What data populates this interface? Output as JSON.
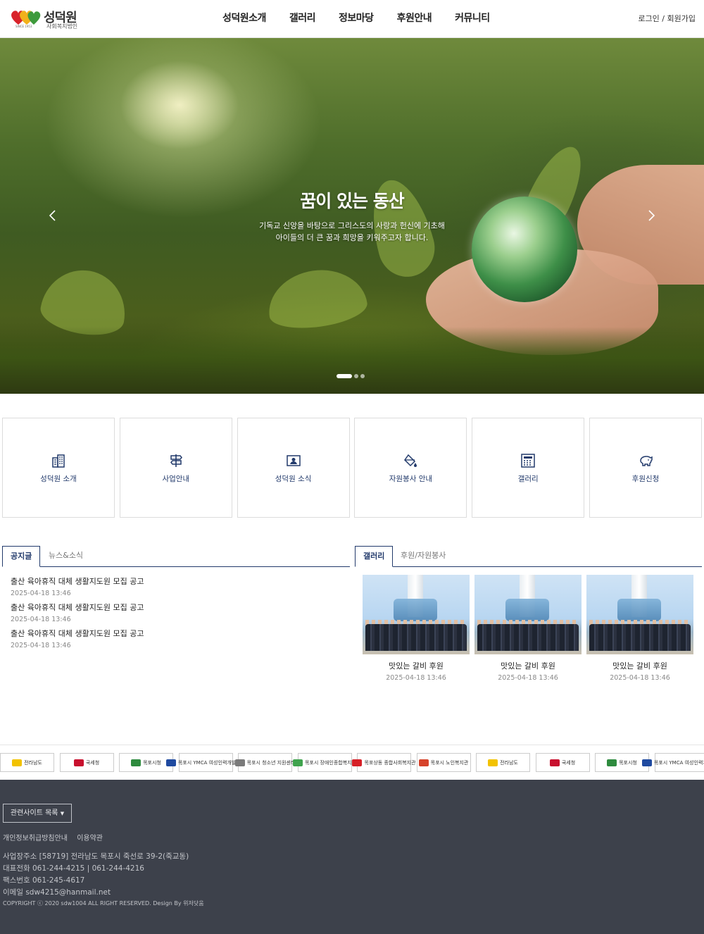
{
  "header": {
    "logo_name": "성덕원",
    "logo_sub": "사회복지법인",
    "logo_since": "SINCE 1953",
    "nav": [
      "성덕원소개",
      "갤러리",
      "정보마당",
      "후원안내",
      "커뮤니티"
    ],
    "login": "로그인",
    "separator": " / ",
    "signup": "회원가입"
  },
  "hero": {
    "title": "꿈이 있는 동산",
    "desc_line1": "기독교 신앙을 바탕으로 그리스도의 사랑과 헌신에 기초해",
    "desc_line2": "아이들의 더 큰 꿈과 희망을 키워주고자 합니다.",
    "slide_count": 3,
    "active_slide": 1
  },
  "quick_menu": [
    {
      "label": "성덕원 소개",
      "icon": "building-icon"
    },
    {
      "label": "사업안내",
      "icon": "signpost-icon"
    },
    {
      "label": "성덕원 소식",
      "icon": "contact-card-icon"
    },
    {
      "label": "자원봉사 안내",
      "icon": "paint-bucket-icon"
    },
    {
      "label": "갤러리",
      "icon": "calculator-icon"
    },
    {
      "label": "후원신청",
      "icon": "piggy-bank-icon"
    }
  ],
  "board": {
    "tab_active": "공지글",
    "tab_other": "뉴스&소식",
    "items": [
      {
        "title": "출산 육아휴직 대체 생활지도원 모집 공고",
        "date": "2025-04-18 13:46"
      },
      {
        "title": "출산 육아휴직 대체 생활지도원 모집 공고",
        "date": "2025-04-18 13:46"
      },
      {
        "title": "출산 육아휴직 대체 생활지도원 모집 공고",
        "date": "2025-04-18 13:46"
      }
    ]
  },
  "gallery": {
    "tab_active": "갤러리",
    "tab_other": "후원/자원봉사",
    "items": [
      {
        "caption": "맛있는 갈비 후원",
        "date": "2025-04-18 13:46"
      },
      {
        "caption": "맛있는 갈비 후원",
        "date": "2025-04-18 13:46"
      },
      {
        "caption": "맛있는 갈비 후원",
        "date": "2025-04-18 13:46"
      }
    ]
  },
  "banners": [
    {
      "label": "전라남도",
      "color": "#f2c200"
    },
    {
      "label": "국세청",
      "color": "#c8102e"
    },
    {
      "label": "목포시청",
      "color": "#2e8b3e"
    },
    {
      "label": "목포시 YMCA 여성인력개발센터",
      "color": "#1f4aa0"
    },
    {
      "label": "목포시 청소년 지원센터",
      "color": "#7a7a7a"
    },
    {
      "label": "목포시 장애인종합복지관",
      "color": "#3fa34d"
    },
    {
      "label": "목포상동 종합사회복지관",
      "color": "#d62027"
    },
    {
      "label": "목포시 노인복지관",
      "color": "#d6432b"
    },
    {
      "label": "전라남도",
      "color": "#f2c200"
    },
    {
      "label": "국세청",
      "color": "#c8102e"
    },
    {
      "label": "목포시청",
      "color": "#2e8b3e"
    },
    {
      "label": "목포시 YMCA 여성인력개발센터",
      "color": "#1f4aa0"
    }
  ],
  "footer": {
    "related_sites": "관련사이트 목록",
    "privacy": "개인정보취급방침안내",
    "terms": "이용약관",
    "address": "사업장주소 [58719] 전라남도 목포시 죽선로 39-2(죽교동)",
    "phone": "대표전화 061-244-4215 | 061-244-4216",
    "fax": "팩스번호 061-245-4617",
    "email": "이메일 sdw4215@hanmail.net",
    "copyright": "COPYRIGHT ⓒ 2020 sdw1004 ALL RIGHT RESERVED. Design By 위저닷움"
  },
  "colors": {
    "accent": "#223a6b",
    "footer_bg": "#3d414b"
  }
}
